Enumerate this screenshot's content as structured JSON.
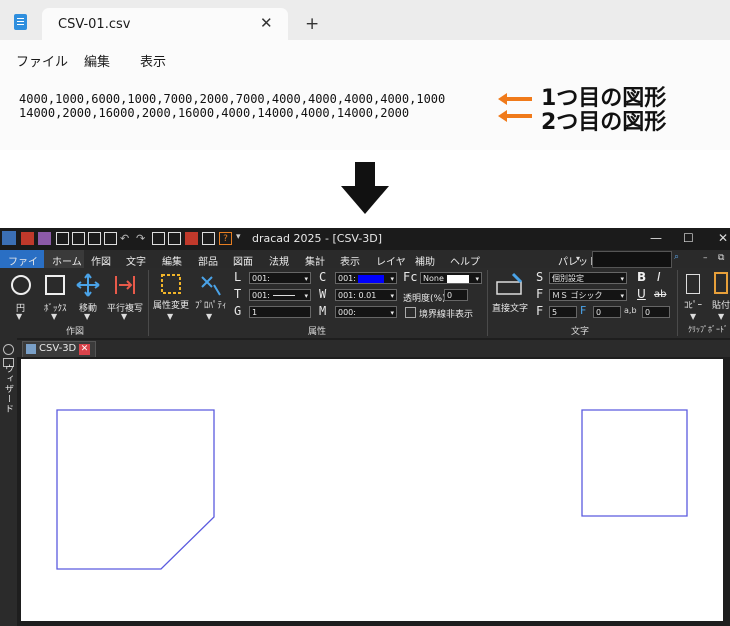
{
  "notepad": {
    "tab_title": "CSV-01.csv",
    "close_glyph": "✕",
    "new_tab_glyph": "+",
    "menu": [
      "ファイル",
      "編集",
      "表示"
    ],
    "lines": [
      "4000,1000,6000,1000,7000,2000,7000,4000,4000,4000,4000,1000",
      "14000,2000,16000,2000,16000,4000,14000,4000,14000,2000"
    ]
  },
  "annotations": {
    "shape1": "1つ目の図形",
    "shape2": "2つ目の図形",
    "arrow_color": "#f07a1a"
  },
  "dracad": {
    "title": "dracad 2025 - [CSV-3D]",
    "window_controls": [
      "—",
      "☐",
      "✕"
    ],
    "ribbon_tabs": [
      "ファイル",
      "ホーム",
      "作図",
      "文字",
      "編集",
      "部品",
      "図面",
      "法規",
      "集計",
      "表示",
      "レイヤ",
      "補助",
      "ヘルプ"
    ],
    "palette_label": "パレット",
    "groups": {
      "draw": {
        "label": "作図",
        "tools": [
          "円",
          "ﾎﾞｯｸｽ",
          "移動",
          "平行複写"
        ]
      },
      "attributes": {
        "label": "属性",
        "change_label": "属性変更",
        "property_label": "ﾌﾟﾛﾊﾟﾃｨ",
        "L": "L",
        "T": "T",
        "G": "G",
        "C": "C",
        "W": "W",
        "M": "M",
        "Fc": "Fc",
        "L_value": "001:",
        "T_value": "001:",
        "G_value": "1",
        "C_value": "001:",
        "W_value": "001: 0.01",
        "M_value": "000:",
        "Fc_value": "None",
        "transparency_label": "透明度(%)",
        "transparency_value": "0",
        "hide_border_label": "境界線非表示"
      },
      "text": {
        "label": "文字",
        "direct_text": "直接文字",
        "S": "S",
        "F": "F",
        "F2": "F",
        "S_value": "個別設定",
        "F_value": "ＭＳ ゴシック",
        "size_value": "5",
        "f_value": "0",
        "ab_value": "0",
        "bold": "B",
        "italic": "I",
        "underline": "U",
        "strike": "ab"
      },
      "clipboard": {
        "label": "ｸﾘｯﾌﾟﾎﾞｰﾄﾞ",
        "copy": "ｺﾋﾟｰ",
        "paste": "貼付"
      }
    },
    "doc_tab": "CSV-3D",
    "side_panel": "ウィザード",
    "shape_color": "#5b5bdf",
    "accent_blue": "#2a6fc4"
  }
}
